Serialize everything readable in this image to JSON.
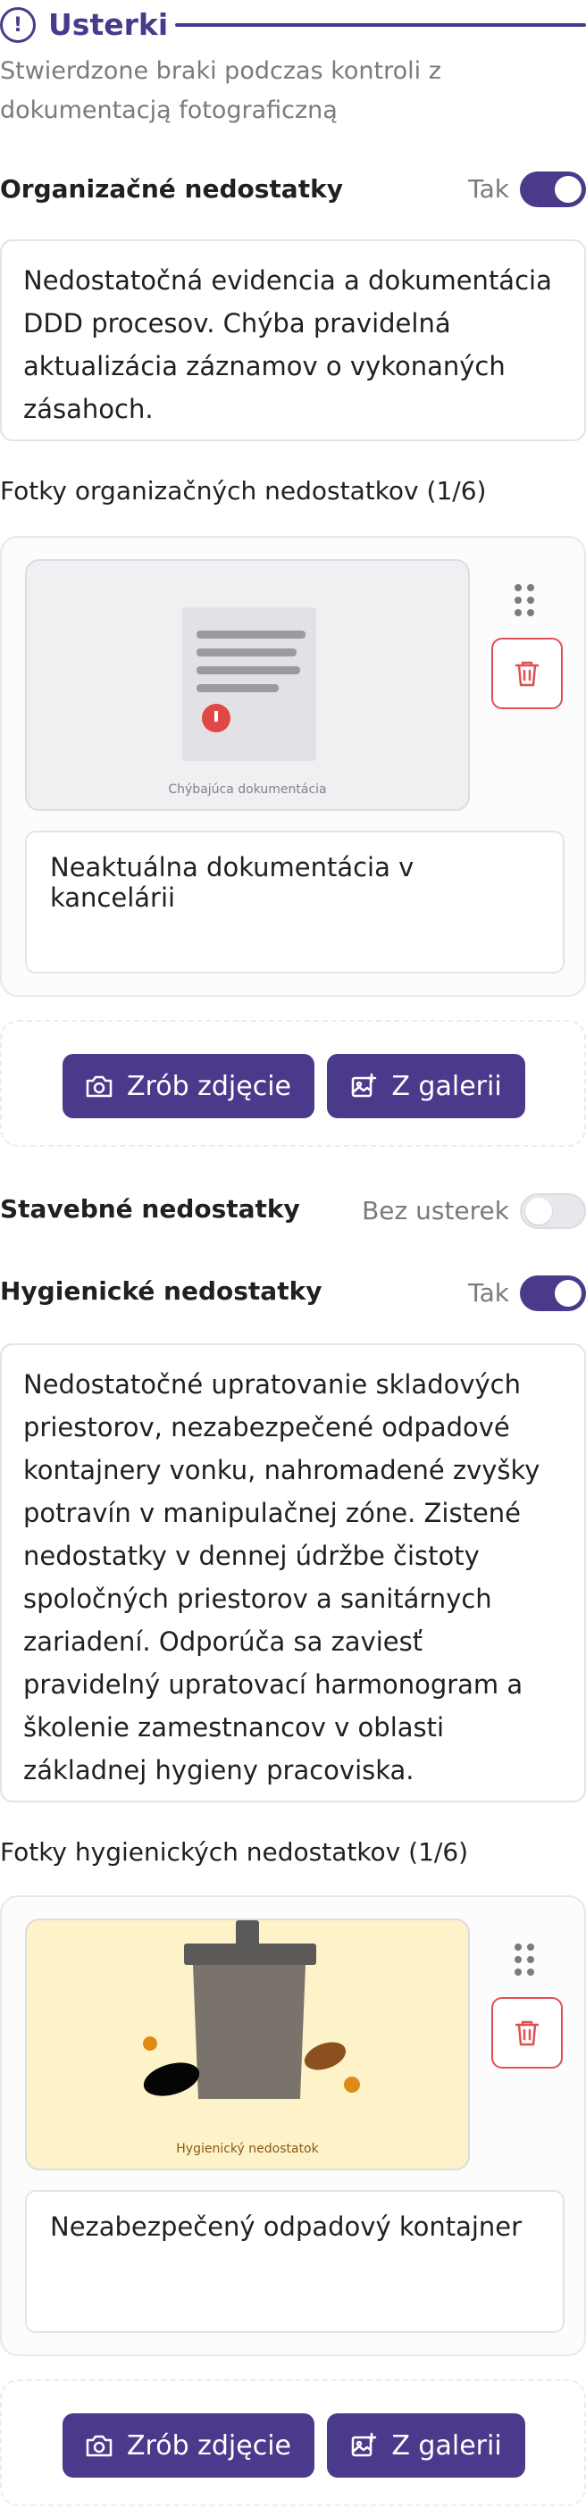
{
  "header": {
    "title": "Usterki",
    "subtitle": "Stwierdzone braki podczas kontroli z dokumentacją fotograficzną"
  },
  "sections": {
    "organizational": {
      "title": "Organizačné nedostatky",
      "toggle_label": "Tak",
      "toggle_on": true,
      "text": "Nedostatočná evidencia a dokumentácia DDD procesov. Chýba pravidelná aktualizácia záznamov o vykonaných zásahoch.",
      "photos_title": "Fotky organizačných nedostatkov (1/6)",
      "photo": {
        "image_caption": "Chýbajúca dokumentácia",
        "description": "Neaktuálna dokumentácia v kancelárii"
      },
      "take_photo_label": "Zrób zdjęcie",
      "gallery_label": "Z galerii"
    },
    "structural": {
      "title": "Stavebné nedostatky",
      "toggle_label": "Bez usterek",
      "toggle_on": false
    },
    "hygiene": {
      "title": "Hygienické nedostatky",
      "toggle_label": "Tak",
      "toggle_on": true,
      "text": "Nedostatočné upratovanie skladových priestorov, nezabezpečené odpadové kontajnery vonku, nahromadené zvyšky potravín v manipulačnej zóne. Zistené nedostatky v dennej údržbe čistoty spoločných priestorov a sanitárnych zariadení. Odporúča sa zaviesť pravidelný upratovací harmonogram a školenie zamestnancov v oblasti základnej hygieny pracoviska.",
      "photos_title": "Fotky hygienických nedostatkov (1/6)",
      "photo": {
        "image_caption": "Hygienický nedostatok",
        "description": "Nezabezpečený odpadový kontajner"
      },
      "take_photo_label": "Zrób zdjęcie",
      "gallery_label": "Z galerii"
    }
  },
  "colors": {
    "accent": "#4b3a8c",
    "danger": "#e05050",
    "muted_text": "#7a7a80"
  },
  "icons": [
    "alert-circle-icon",
    "drag-handle-icon",
    "trash-icon",
    "camera-icon",
    "gallery-icon"
  ]
}
